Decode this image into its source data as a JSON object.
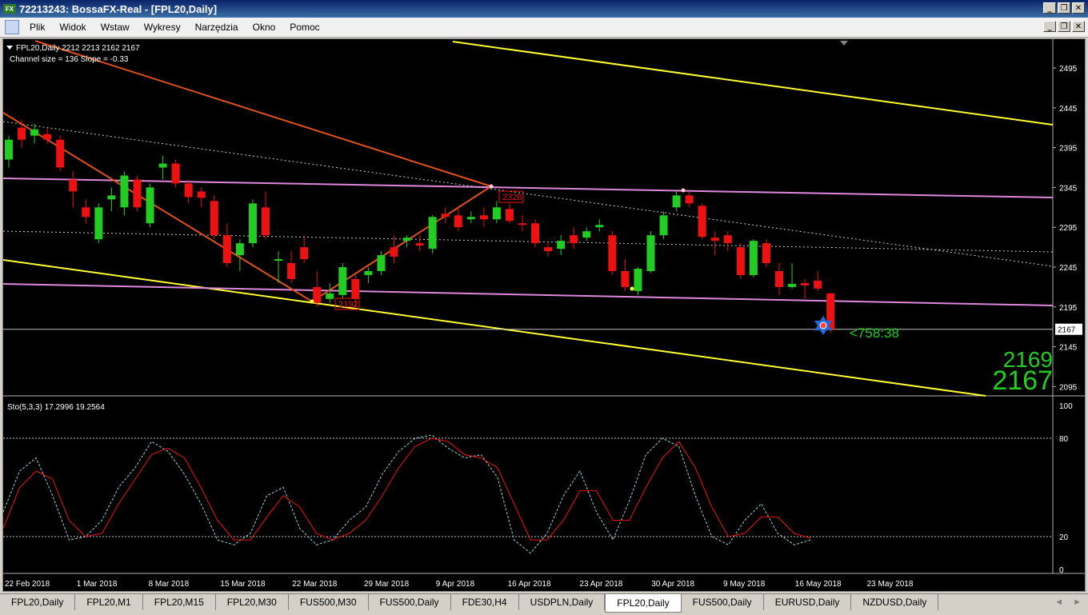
{
  "window": {
    "title": "72213243: BossaFX-Real - [FPL20,Daily]",
    "icon_label": "FX"
  },
  "window_buttons": [
    "_",
    "❐",
    "✕"
  ],
  "menu": [
    "Plik",
    "Widok",
    "Wstaw",
    "Wykresy",
    "Narzędzia",
    "Okno",
    "Pomoc"
  ],
  "chart": {
    "header_line1": "FPL20,Daily  2212 2213 2162 2167",
    "header_line2": "Channel size = 136 Slope = -0.33",
    "price_ticks": [
      "2495",
      "2445",
      "2395",
      "2345",
      "2295",
      "2245",
      "2195",
      "2145",
      "2095"
    ],
    "current_price_label": "2167",
    "countdown": "<758:38",
    "big_price_top": "2169",
    "big_price_bottom": "2167",
    "marker_low": "2192",
    "marker_high": "2328",
    "dates": [
      "22 Feb 2018",
      "1 Mar 2018",
      "8 Mar 2018",
      "15 Mar 2018",
      "22 Mar 2018",
      "29 Mar 2018",
      "9 Apr 2018",
      "16 Apr 2018",
      "23 Apr 2018",
      "30 Apr 2018",
      "9 May 2018",
      "16 May 2018",
      "23 May 2018"
    ],
    "colors": {
      "bull": "#22cc22",
      "bear": "#ee1111",
      "channel": "#ffff33",
      "mid": "#dd88dd",
      "trend": "#e05020"
    }
  },
  "indicator": {
    "label": "Sto(5,3,3) 17.2996 19.2564",
    "ticks": [
      "100",
      "80",
      "20",
      "0"
    ]
  },
  "chart_data": {
    "type": "candlestick",
    "series": [
      {
        "name": "FPL20,Daily",
        "ohlc": [
          [
            2380,
            2410,
            2370,
            2405
          ],
          [
            2420,
            2430,
            2395,
            2405
          ],
          [
            2410,
            2425,
            2400,
            2418
          ],
          [
            2412,
            2420,
            2400,
            2405
          ],
          [
            2405,
            2410,
            2365,
            2370
          ],
          [
            2355,
            2365,
            2320,
            2340
          ],
          [
            2320,
            2330,
            2300,
            2308
          ],
          [
            2280,
            2325,
            2275,
            2320
          ],
          [
            2330,
            2345,
            2315,
            2335
          ],
          [
            2320,
            2365,
            2310,
            2360
          ],
          [
            2355,
            2360,
            2315,
            2320
          ],
          [
            2300,
            2350,
            2295,
            2345
          ],
          [
            2370,
            2385,
            2355,
            2375
          ],
          [
            2375,
            2380,
            2345,
            2350
          ],
          [
            2350,
            2355,
            2325,
            2333
          ],
          [
            2340,
            2345,
            2320,
            2332
          ],
          [
            2328,
            2335,
            2280,
            2285
          ],
          [
            2285,
            2300,
            2245,
            2250
          ],
          [
            2260,
            2280,
            2240,
            2275
          ],
          [
            2275,
            2330,
            2270,
            2325
          ],
          [
            2320,
            2340,
            2280,
            2285
          ],
          [
            2255,
            2265,
            2225,
            2255
          ],
          [
            2250,
            2265,
            2225,
            2230
          ],
          [
            2270,
            2285,
            2250,
            2255
          ],
          [
            2220,
            2240,
            2195,
            2200
          ],
          [
            2205,
            2225,
            2200,
            2212
          ],
          [
            2210,
            2250,
            2205,
            2245
          ],
          [
            2230,
            2235,
            2195,
            2205
          ],
          [
            2235,
            2245,
            2225,
            2240
          ],
          [
            2240,
            2265,
            2235,
            2260
          ],
          [
            2270,
            2285,
            2250,
            2258
          ],
          [
            2278,
            2285,
            2270,
            2282
          ],
          [
            2275,
            2285,
            2265,
            2272
          ],
          [
            2268,
            2310,
            2262,
            2308
          ],
          [
            2312,
            2320,
            2300,
            2308
          ],
          [
            2310,
            2320,
            2290,
            2295
          ],
          [
            2305,
            2315,
            2300,
            2308
          ],
          [
            2310,
            2320,
            2295,
            2305
          ],
          [
            2305,
            2328,
            2300,
            2320
          ],
          [
            2318,
            2325,
            2300,
            2303
          ],
          [
            2300,
            2310,
            2290,
            2298
          ],
          [
            2300,
            2305,
            2270,
            2275
          ],
          [
            2270,
            2275,
            2258,
            2265
          ],
          [
            2268,
            2285,
            2260,
            2278
          ],
          [
            2285,
            2295,
            2268,
            2275
          ],
          [
            2282,
            2295,
            2278,
            2290
          ],
          [
            2295,
            2305,
            2290,
            2298
          ],
          [
            2285,
            2290,
            2235,
            2240
          ],
          [
            2240,
            2255,
            2215,
            2220
          ],
          [
            2215,
            2245,
            2210,
            2243
          ],
          [
            2240,
            2290,
            2238,
            2285
          ],
          [
            2285,
            2315,
            2280,
            2310
          ],
          [
            2320,
            2340,
            2315,
            2335
          ],
          [
            2335,
            2340,
            2320,
            2325
          ],
          [
            2322,
            2325,
            2280,
            2283
          ],
          [
            2282,
            2290,
            2260,
            2278
          ],
          [
            2285,
            2290,
            2265,
            2275
          ],
          [
            2270,
            2275,
            2230,
            2235
          ],
          [
            2235,
            2280,
            2232,
            2278
          ],
          [
            2275,
            2280,
            2245,
            2250
          ],
          [
            2240,
            2250,
            2210,
            2220
          ],
          [
            2220,
            2250,
            2218,
            2224
          ],
          [
            2225,
            2230,
            2205,
            2222
          ],
          [
            2228,
            2240,
            2215,
            2218
          ],
          [
            2212,
            2213,
            2162,
            2167
          ]
        ]
      },
      {
        "name": "Sto %K",
        "values": [
          35,
          60,
          68,
          45,
          18,
          20,
          30,
          50,
          62,
          78,
          72,
          58,
          40,
          18,
          15,
          22,
          45,
          50,
          25,
          15,
          18,
          30,
          38,
          58,
          72,
          80,
          82,
          74,
          68,
          70,
          56,
          18,
          10,
          22,
          45,
          60,
          35,
          18,
          42,
          70,
          80,
          75,
          45,
          20,
          15,
          30,
          40,
          22,
          15,
          18
        ]
      },
      {
        "name": "Sto %D",
        "values": [
          25,
          50,
          60,
          55,
          30,
          20,
          22,
          40,
          55,
          70,
          74,
          68,
          50,
          30,
          18,
          18,
          32,
          45,
          38,
          22,
          18,
          22,
          30,
          45,
          62,
          75,
          80,
          78,
          70,
          68,
          62,
          40,
          18,
          18,
          30,
          48,
          48,
          30,
          30,
          50,
          68,
          78,
          62,
          38,
          20,
          22,
          32,
          32,
          22,
          19
        ]
      }
    ]
  }
}
